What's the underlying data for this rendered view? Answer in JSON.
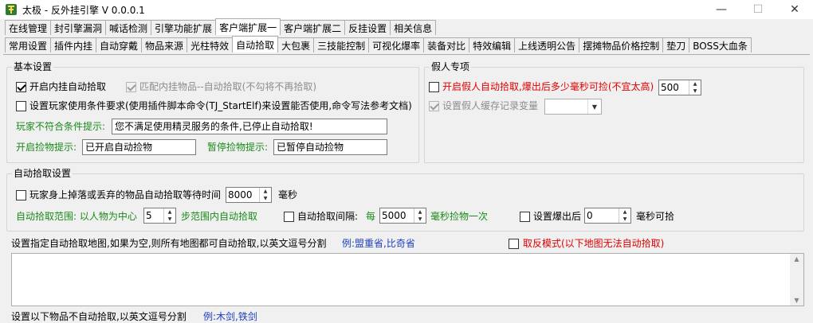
{
  "window": {
    "title": "太极 - 反外挂引擎 V 0.0.0.1",
    "controls": {
      "minimize": "—",
      "maximize": "☐",
      "close": "✕"
    }
  },
  "tabs_row1": [
    "在线管理",
    "封引擎漏洞",
    "喊话检测",
    "引擎功能扩展",
    "客户端扩展一",
    "客户端扩展二",
    "反挂设置",
    "相关信息"
  ],
  "tabs_row2": [
    "常用设置",
    "插件内挂",
    "自动穿戴",
    "物品来源",
    "光柱特效",
    "自动拾取",
    "大包裹",
    "三技能控制",
    "可视化爆率",
    "装备对比",
    "特效编辑",
    "上线透明公告",
    "摆摊物品价格控制",
    "垫刀",
    "BOSS大血条"
  ],
  "basic": {
    "title": "基本设置",
    "enable_autopick": "开启内挂自动拾取",
    "match_plugin": "匹配内挂物品--自动拾取(不勾将不再拾取)",
    "set_condition": "设置玩家使用条件要求(使用插件脚本命令(TJ_StartElf)来设置能否使用,命令写法参考文档)",
    "unmet_label": "玩家不符合条件提示:",
    "unmet_value": "您不满足使用精灵服务的条件,已停止自动拾取!",
    "start_label": "开启捡物提示:",
    "start_value": "已开启自动捡物",
    "pause_label": "暂停捡物提示:",
    "pause_value": "已暂停自动捡物"
  },
  "fake": {
    "title": "假人专项",
    "enable_fake": "开启假人自动拾取,爆出后多少毫秒可捡(不宜太高)",
    "fake_ms": "500",
    "cache_var": "设置假人缓存记录变量",
    "cache_value": ""
  },
  "autopick": {
    "title": "自动拾取设置",
    "wait_label": "玩家身上掉落或丢弃的物品自动拾取等待时间",
    "wait_value": "8000",
    "wait_unit": "毫秒",
    "range_label": "自动拾取范围: 以人物为中心",
    "range_value": "5",
    "range_unit": "步范围内自动拾取",
    "interval_label": "自动拾取间隔: ",
    "interval_every": "每",
    "interval_value": "5000",
    "interval_unit": "毫秒捡物一次",
    "drop_label": "设置爆出后",
    "drop_value": "0",
    "drop_unit": "毫秒可拾"
  },
  "maps": {
    "label": "设置指定自动拾取地图,如果为空,则所有地图都可自动拾取,以英文逗号分割",
    "example": "例:盟重省,比奇省",
    "invert": "取反模式(以下地图无法自动拾取)",
    "text": ""
  },
  "items": {
    "label": "设置以下物品不自动拾取,以英文逗号分割",
    "example": "例:木剑,铁剑"
  }
}
